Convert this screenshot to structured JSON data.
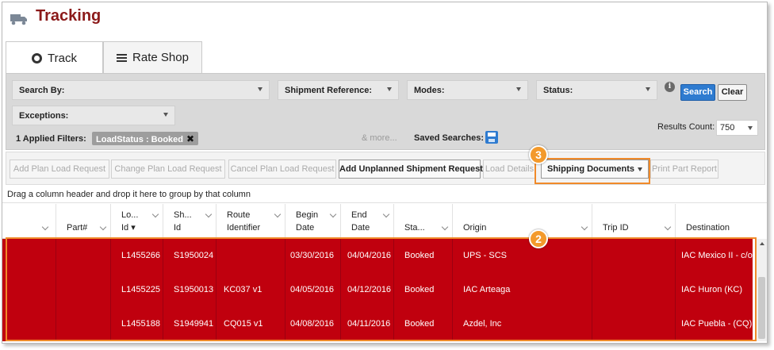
{
  "header": {
    "title": "Tracking",
    "icon": "truck-icon"
  },
  "tabs": [
    {
      "label": "Track",
      "icon": "radio-icon",
      "active": true
    },
    {
      "label": "Rate Shop",
      "icon": "menu-icon",
      "active": false
    }
  ],
  "filters": {
    "search_by": "Search By:",
    "shipment_reference": "Shipment Reference:",
    "modes": "Modes:",
    "status": "Status:",
    "exceptions": "Exceptions:",
    "search_button": "Search",
    "clear_button": "Clear",
    "applied_label": "1 Applied Filters:",
    "applied_chip": "LoadStatus : Booked",
    "more_link": "& more...",
    "saved_searches": "Saved Searches:",
    "results_count_label": "Results Count:",
    "results_count_value": "750"
  },
  "toolbar": {
    "add_plan": "Add Plan Load Request",
    "change_plan": "Change Plan Load Request",
    "cancel_plan": "Cancel Plan Load Request",
    "add_unplanned": "Add Unplanned Shipment Request",
    "load_details": "Load Details",
    "shipping_documents": "Shipping Documents",
    "print_part": "Print Part Report"
  },
  "groupbar": {
    "text": "Drag a column header and drop it here to group by that column"
  },
  "grid": {
    "headers": {
      "part": "Part#",
      "load_id_1": "Lo...",
      "load_id_2": "Id ▾",
      "sh_id_1": "Sh...",
      "sh_id_2": "Id",
      "route_1": "Route",
      "route_2": "Identifier",
      "begin_1": "Begin",
      "begin_2": "Date",
      "end_1": "End",
      "end_2": "Date",
      "status": "Sta...",
      "origin": "Origin",
      "trip": "Trip ID",
      "destination": "Destination"
    },
    "rows": [
      {
        "load_id": "L1455266",
        "sh_id": "S1950024",
        "route": "",
        "begin": "03/30/2016",
        "end": "04/04/2016",
        "status": "Booked",
        "origin": "UPS - SCS",
        "trip": "",
        "destination": "IAC Mexico II - c/o S"
      },
      {
        "load_id": "L1455225",
        "sh_id": "S1950013",
        "route": "KC037 v1",
        "begin": "04/05/2016",
        "end": "04/12/2016",
        "status": "Booked",
        "origin": "IAC Arteaga",
        "trip": "",
        "destination": "IAC Huron (KC)"
      },
      {
        "load_id": "L1455188",
        "sh_id": "S1949941",
        "route": "CQ015 v1",
        "begin": "04/08/2016",
        "end": "04/11/2016",
        "status": "Booked",
        "origin": "Azdel, Inc",
        "trip": "",
        "destination": "IAC Puebla - (CQ) c"
      }
    ],
    "row_color": "#c0000e"
  },
  "callouts": {
    "badge_3": "3",
    "badge_2": "2",
    "color": "#f39a2c"
  }
}
